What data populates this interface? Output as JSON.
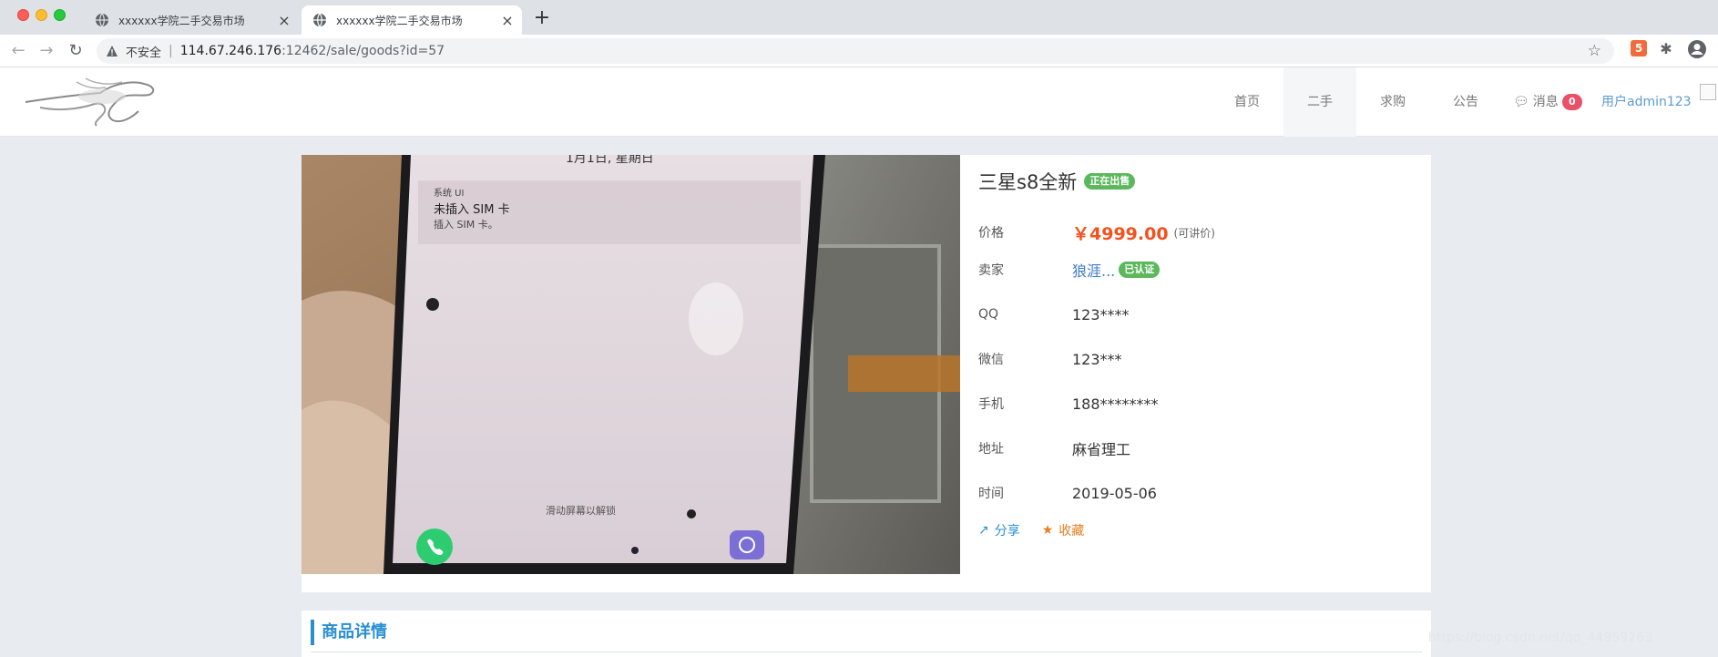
{
  "browser": {
    "tabs": [
      {
        "title": "xxxxxx学院二手交易市场",
        "active": false
      },
      {
        "title": "xxxxxx学院二手交易市场",
        "active": true
      }
    ],
    "insecure_label": "不安全",
    "url_host": "114.67.246.176",
    "url_rest": ":12462/sale/goods?id=57"
  },
  "header": {
    "nav": [
      {
        "label": "首页",
        "active": false
      },
      {
        "label": "二手",
        "active": true
      },
      {
        "label": "求购",
        "active": false
      },
      {
        "label": "公告",
        "active": false
      }
    ],
    "messages_label": "消息",
    "messages_count": "0",
    "user_label": "用户admin123"
  },
  "product": {
    "title": "三星s8全新",
    "status": "正在出售",
    "price_label": "价格",
    "price": "￥4999.00",
    "price_note": "(可讲价)",
    "seller_label": "卖家",
    "seller_name": "狼涯...",
    "seller_badge": "已认证",
    "qq_label": "QQ",
    "qq": "123****",
    "wechat_label": "微信",
    "wechat": "123***",
    "phone_label": "手机",
    "phone": "188********",
    "address_label": "地址",
    "address": "麻省理工",
    "time_label": "时间",
    "time": "2019-05-06",
    "share_label": "分享",
    "favorite_label": "收藏",
    "photo_text": {
      "date_line": "1月1日, 星期日",
      "notif_app": "系统 UI",
      "notif_title": "未插入 SIM 卡",
      "notif_body": "插入 SIM 卡。",
      "unlock_hint": "滑动屏幕以解锁"
    }
  },
  "details": {
    "heading": "商品详情"
  },
  "watermark": "https://blog.csdn.net/qq_44959263"
}
